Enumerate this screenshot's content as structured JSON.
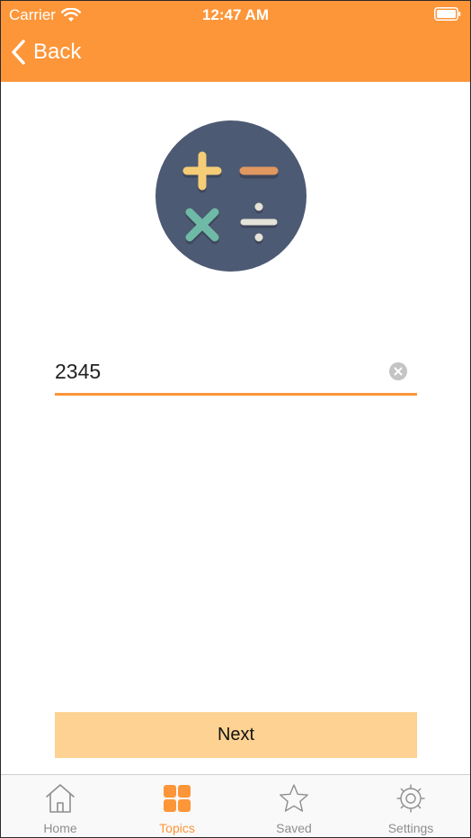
{
  "status_bar": {
    "carrier": "Carrier",
    "time": "12:47 AM",
    "wifi_icon": "wifi-icon",
    "battery_icon": "battery-icon"
  },
  "nav": {
    "back_label": "Back",
    "back_icon": "chevron-left-icon"
  },
  "logo": {
    "icon": "calculator-operators-icon",
    "colors": {
      "circle": "#4d5a73",
      "plus": "#f5cd76",
      "minus": "#e19760",
      "times": "#6ebaa6",
      "divide": "#e5e2d7"
    }
  },
  "input": {
    "value": "2345",
    "clear_icon": "clear-icon"
  },
  "next_button": {
    "label": "Next"
  },
  "tabs": [
    {
      "label": "Home",
      "icon": "home-icon",
      "active": false
    },
    {
      "label": "Topics",
      "icon": "topics-grid-icon",
      "active": true
    },
    {
      "label": "Saved",
      "icon": "star-icon",
      "active": false
    },
    {
      "label": "Settings",
      "icon": "gear-icon",
      "active": false
    }
  ],
  "colors": {
    "accent": "#fd9639",
    "button_fill": "#fdd292",
    "tab_inactive": "#8e8e8e"
  }
}
